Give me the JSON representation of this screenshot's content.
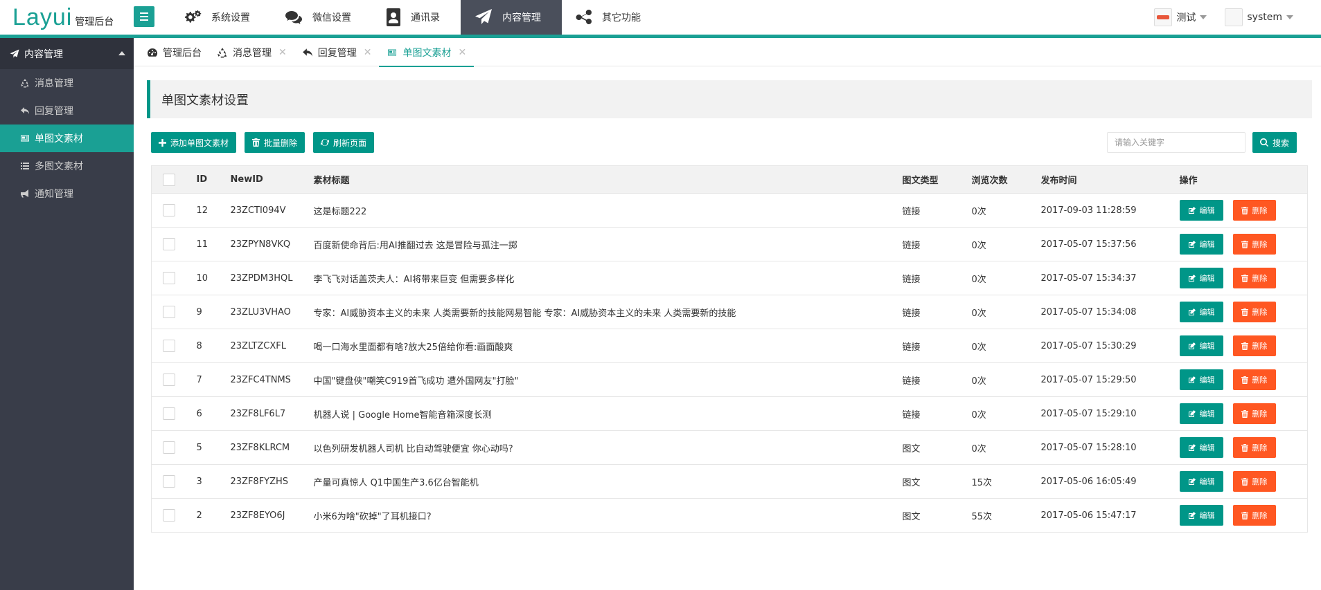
{
  "brand": {
    "logo": "Layui",
    "subtitle": "管理后台"
  },
  "topnav": [
    {
      "label": "系统设置",
      "icon": "gears-icon"
    },
    {
      "label": "微信设置",
      "icon": "chat-icon"
    },
    {
      "label": "通讯录",
      "icon": "contact-icon"
    },
    {
      "label": "内容管理",
      "icon": "send-icon",
      "active": true
    },
    {
      "label": "其它功能",
      "icon": "share-icon"
    }
  ],
  "user": {
    "tenant": "测试",
    "account": "system"
  },
  "sidebar": {
    "group": "内容管理",
    "items": [
      {
        "label": "消息管理",
        "icon": "recycle-icon"
      },
      {
        "label": "回复管理",
        "icon": "reply-icon"
      },
      {
        "label": "单图文素材",
        "icon": "newspaper-icon",
        "active": true
      },
      {
        "label": "多图文素材",
        "icon": "list-icon"
      },
      {
        "label": "通知管理",
        "icon": "bullhorn-icon"
      }
    ]
  },
  "tabs": [
    {
      "label": "管理后台",
      "icon": "dashboard-icon",
      "closable": false
    },
    {
      "label": "消息管理",
      "icon": "recycle-icon",
      "closable": true
    },
    {
      "label": "回复管理",
      "icon": "reply-icon",
      "closable": true
    },
    {
      "label": "单图文素材",
      "icon": "newspaper-icon",
      "closable": true,
      "active": true
    }
  ],
  "page": {
    "title": "单图文素材设置",
    "add_label": "添加单图文素材",
    "batch_delete_label": "批量删除",
    "refresh_label": "刷新页面",
    "search_placeholder": "请输入关键字",
    "search_label": "搜索"
  },
  "table": {
    "headers": {
      "id": "ID",
      "newid": "NewID",
      "title": "素材标题",
      "type": "图文类型",
      "views": "浏览次数",
      "time": "发布时间",
      "ops": "操作"
    },
    "edit_label": "编辑",
    "delete_label": "删除",
    "rows": [
      {
        "id": "12",
        "newid": "23ZCTI094V",
        "title": "这是标题222",
        "type": "链接",
        "views": "0次",
        "time": "2017-09-03 11:28:59"
      },
      {
        "id": "11",
        "newid": "23ZPYN8VKQ",
        "title": "百度新使命背后:用AI推翻过去 这是冒险与孤注一掷",
        "type": "链接",
        "views": "0次",
        "time": "2017-05-07 15:37:56"
      },
      {
        "id": "10",
        "newid": "23ZPDM3HQL",
        "title": "李飞飞对话盖茨夫人：AI将带来巨变 但需要多样化",
        "type": "链接",
        "views": "0次",
        "time": "2017-05-07 15:34:37"
      },
      {
        "id": "9",
        "newid": "23ZLU3VHAO",
        "title": "专家：AI威胁资本主义的未来 人类需要新的技能网易智能 专家：AI威胁资本主义的未来 人类需要新的技能",
        "type": "链接",
        "views": "0次",
        "time": "2017-05-07 15:34:08"
      },
      {
        "id": "8",
        "newid": "23ZLTZCXFL",
        "title": "喝一口海水里面都有啥?放大25倍给你看:画面酸爽",
        "type": "链接",
        "views": "0次",
        "time": "2017-05-07 15:30:29"
      },
      {
        "id": "7",
        "newid": "23ZFC4TNMS",
        "title": "中国\"键盘侠\"嘲笑C919首飞成功 遭外国网友\"打脸\"",
        "type": "链接",
        "views": "0次",
        "time": "2017-05-07 15:29:50"
      },
      {
        "id": "6",
        "newid": "23ZF8LF6L7",
        "title": "机器人说 | Google Home智能音箱深度长测",
        "type": "链接",
        "views": "0次",
        "time": "2017-05-07 15:29:10"
      },
      {
        "id": "5",
        "newid": "23ZF8KLRCM",
        "title": "以色列研发机器人司机 比自动驾驶便宜 你心动吗?",
        "type": "图文",
        "views": "0次",
        "time": "2017-05-07 15:28:10"
      },
      {
        "id": "3",
        "newid": "23ZF8FYZHS",
        "title": "产量可真惊人 Q1中国生产3.6亿台智能机",
        "type": "图文",
        "views": "15次",
        "time": "2017-05-06 16:05:49"
      },
      {
        "id": "2",
        "newid": "23ZF8EYO6J",
        "title": "小米6为啥\"砍掉\"了耳机接口?",
        "type": "图文",
        "views": "55次",
        "time": "2017-05-06 15:47:17"
      }
    ]
  },
  "colors": {
    "primary": "#009688",
    "accent": "#1aa094",
    "danger": "#ff5722",
    "sidebar_bg": "#393d49",
    "nav_active": "#4a4f5b"
  }
}
